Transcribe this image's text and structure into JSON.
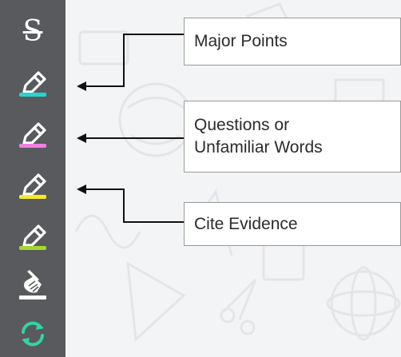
{
  "toolbar": {
    "tools": [
      {
        "name": "strikethrough-tool",
        "icon": "strikethrough-icon",
        "glyph": "S"
      },
      {
        "name": "highlighter-cyan-tool",
        "icon": "highlighter-icon",
        "color": "#27d4cf"
      },
      {
        "name": "highlighter-pink-tool",
        "icon": "highlighter-icon",
        "color": "#f07fe2"
      },
      {
        "name": "highlighter-yellow-tool",
        "icon": "highlighter-icon",
        "color": "#f5ea2a"
      },
      {
        "name": "highlighter-green-tool",
        "icon": "highlighter-icon",
        "color": "#a8d630"
      },
      {
        "name": "eraser-tool",
        "icon": "eraser-broom-icon"
      },
      {
        "name": "reset-tool",
        "icon": "refresh-icon",
        "color": "#33d3a6"
      }
    ]
  },
  "legend": {
    "major_points": "Major Points",
    "questions_line1": "Questions or",
    "questions_line2": "Unfamiliar Words",
    "cite_evidence": "Cite Evidence"
  }
}
